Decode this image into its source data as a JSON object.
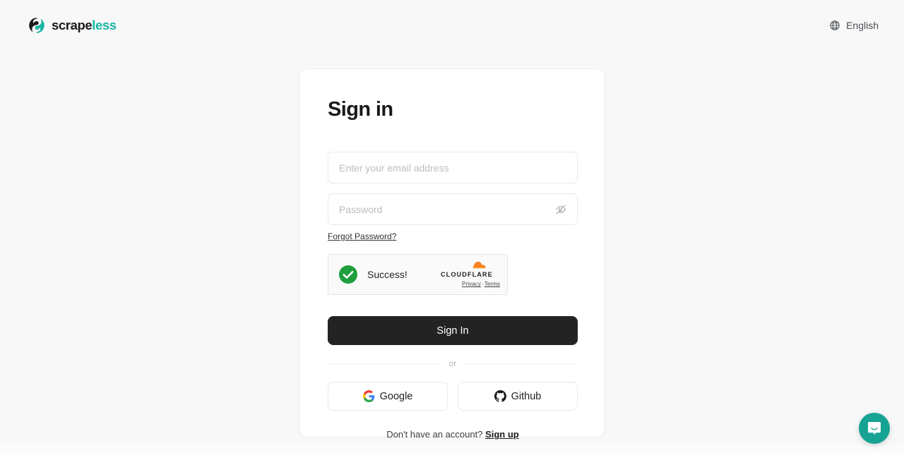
{
  "header": {
    "brand": {
      "name_dark": "scrape",
      "name_accent": "less",
      "logo_icon": "scrapeless-swirl-logo",
      "accent_color": "#17b8a6"
    },
    "language": {
      "icon": "globe-icon",
      "label": "English"
    }
  },
  "card": {
    "title": "Sign in",
    "email": {
      "placeholder": "Enter your email address",
      "value": ""
    },
    "password": {
      "placeholder": "Password",
      "value": "",
      "toggle_icon": "eye-off-icon"
    },
    "forgot_password_label": "Forgot Password?",
    "turnstile": {
      "status_text": "Success!",
      "status_icon": "green-check-circle-icon",
      "status_color": "#1e9e3d",
      "brand_name": "CLOUDFLARE",
      "brand_icon": "cloudflare-cloud-icon",
      "brand_color": "#f6821f",
      "privacy_label": "Privacy",
      "separator": "·",
      "terms_label": "Terms"
    },
    "submit_label": "Sign In",
    "divider_label": "or",
    "social": [
      {
        "label": "Google",
        "icon": "google-g-icon"
      },
      {
        "label": "Github",
        "icon": "github-octocat-icon"
      }
    ],
    "footer": {
      "prompt": "Don't have an account?",
      "signup_label": "Sign up"
    }
  },
  "chat": {
    "icon": "intercom-chat-icon",
    "color": "#16a394"
  }
}
